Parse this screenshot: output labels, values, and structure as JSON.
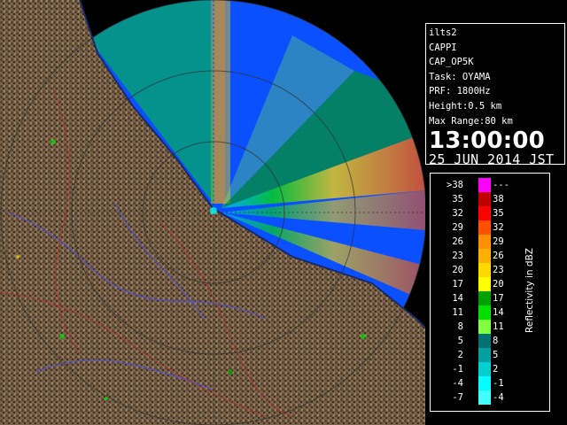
{
  "info": {
    "radar": "ilts2",
    "product": "CAPPI",
    "config": "CAP_OP5K",
    "task": "Task: OYAMA",
    "prf": "PRF: 1800Hz",
    "height": "Height:0.5 km",
    "max_range": "Max Range:80 km",
    "time": "13:00:00",
    "date": "25 JUN 2014 JST"
  },
  "scale": {
    "title": "Reflectivity in dBZ",
    "rows": [
      {
        "lo": ">38",
        "hi": "---",
        "color": "#ff00ff"
      },
      {
        "lo": "35",
        "hi": "38",
        "color": "#c00000"
      },
      {
        "lo": "32",
        "hi": "35",
        "color": "#ff0000"
      },
      {
        "lo": "29",
        "hi": "32",
        "color": "#ff5000"
      },
      {
        "lo": "26",
        "hi": "29",
        "color": "#ff9000"
      },
      {
        "lo": "23",
        "hi": "26",
        "color": "#ffb000"
      },
      {
        "lo": "20",
        "hi": "23",
        "color": "#ffd800"
      },
      {
        "lo": "17",
        "hi": "20",
        "color": "#ffff00"
      },
      {
        "lo": "14",
        "hi": "17",
        "color": "#00a000"
      },
      {
        "lo": "11",
        "hi": "14",
        "color": "#00e000"
      },
      {
        "lo": "8",
        "hi": "11",
        "color": "#80ff40"
      },
      {
        "lo": "5",
        "hi": "8",
        "color": "#007070"
      },
      {
        "lo": "2",
        "hi": "5",
        "color": "#00a0a0"
      },
      {
        "lo": "-1",
        "hi": "2",
        "color": "#00d0d0"
      },
      {
        "lo": "-4",
        "hi": "-1",
        "color": "#00ffff"
      },
      {
        "lo": "-7",
        "hi": "-4",
        "color": "#40ffff"
      }
    ]
  },
  "map": {
    "background_color": "#000000",
    "radar_coverage_color": "#0a50ff",
    "land_color": "#7a6248",
    "land_shadow_color": "#3c2e22",
    "coastline_color": "#1a2a66",
    "river_color": "#5050d8",
    "boundary_color": "#b03030",
    "range_ring_color": "#303030"
  }
}
